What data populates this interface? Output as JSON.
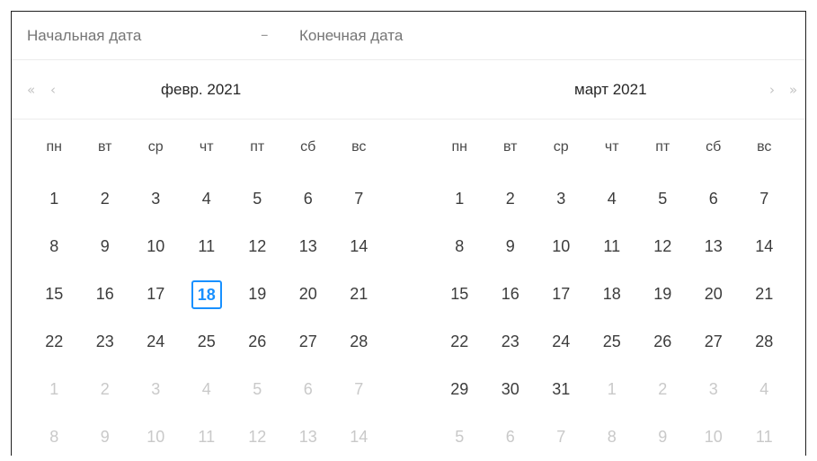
{
  "range_input": {
    "start_placeholder": "Начальная дата",
    "separator": "–",
    "end_placeholder": "Конечная дата"
  },
  "nav": {
    "prev_year": "«",
    "prev_month": "‹",
    "next_month": "›",
    "next_year": "»"
  },
  "weekdays": [
    "пн",
    "вт",
    "ср",
    "чт",
    "пт",
    "сб",
    "вс"
  ],
  "left_panel": {
    "title": "февр. 2021",
    "today": 18,
    "weeks": [
      [
        [
          1,
          0
        ],
        [
          2,
          0
        ],
        [
          3,
          0
        ],
        [
          4,
          0
        ],
        [
          5,
          0
        ],
        [
          6,
          0
        ],
        [
          7,
          0
        ]
      ],
      [
        [
          8,
          0
        ],
        [
          9,
          0
        ],
        [
          10,
          0
        ],
        [
          11,
          0
        ],
        [
          12,
          0
        ],
        [
          13,
          0
        ],
        [
          14,
          0
        ]
      ],
      [
        [
          15,
          0
        ],
        [
          16,
          0
        ],
        [
          17,
          0
        ],
        [
          18,
          0
        ],
        [
          19,
          0
        ],
        [
          20,
          0
        ],
        [
          21,
          0
        ]
      ],
      [
        [
          22,
          0
        ],
        [
          23,
          0
        ],
        [
          24,
          0
        ],
        [
          25,
          0
        ],
        [
          26,
          0
        ],
        [
          27,
          0
        ],
        [
          28,
          0
        ]
      ],
      [
        [
          1,
          1
        ],
        [
          2,
          1
        ],
        [
          3,
          1
        ],
        [
          4,
          1
        ],
        [
          5,
          1
        ],
        [
          6,
          1
        ],
        [
          7,
          1
        ]
      ],
      [
        [
          8,
          1
        ],
        [
          9,
          1
        ],
        [
          10,
          1
        ],
        [
          11,
          1
        ],
        [
          12,
          1
        ],
        [
          13,
          1
        ],
        [
          14,
          1
        ]
      ]
    ]
  },
  "right_panel": {
    "title": "март 2021",
    "today": null,
    "weeks": [
      [
        [
          1,
          0
        ],
        [
          2,
          0
        ],
        [
          3,
          0
        ],
        [
          4,
          0
        ],
        [
          5,
          0
        ],
        [
          6,
          0
        ],
        [
          7,
          0
        ]
      ],
      [
        [
          8,
          0
        ],
        [
          9,
          0
        ],
        [
          10,
          0
        ],
        [
          11,
          0
        ],
        [
          12,
          0
        ],
        [
          13,
          0
        ],
        [
          14,
          0
        ]
      ],
      [
        [
          15,
          0
        ],
        [
          16,
          0
        ],
        [
          17,
          0
        ],
        [
          18,
          0
        ],
        [
          19,
          0
        ],
        [
          20,
          0
        ],
        [
          21,
          0
        ]
      ],
      [
        [
          22,
          0
        ],
        [
          23,
          0
        ],
        [
          24,
          0
        ],
        [
          25,
          0
        ],
        [
          26,
          0
        ],
        [
          27,
          0
        ],
        [
          28,
          0
        ]
      ],
      [
        [
          29,
          0
        ],
        [
          30,
          0
        ],
        [
          31,
          0
        ],
        [
          1,
          1
        ],
        [
          2,
          1
        ],
        [
          3,
          1
        ],
        [
          4,
          1
        ]
      ],
      [
        [
          5,
          1
        ],
        [
          6,
          1
        ],
        [
          7,
          1
        ],
        [
          8,
          1
        ],
        [
          9,
          1
        ],
        [
          10,
          1
        ],
        [
          11,
          1
        ]
      ]
    ]
  },
  "colors": {
    "accent": "#1890ff",
    "text": "#3c3c3c",
    "muted": "#c9c9c9",
    "placeholder": "#b8b8b8"
  }
}
